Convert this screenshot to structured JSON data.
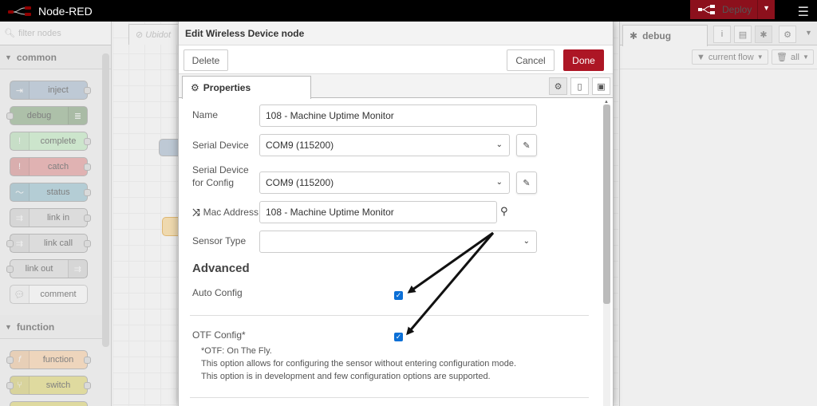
{
  "app": {
    "title": "Node-RED",
    "deploy_label": "Deploy"
  },
  "palette": {
    "filter_placeholder": "filter nodes",
    "categories": [
      {
        "label": "common",
        "nodes": [
          "inject",
          "debug",
          "complete",
          "catch",
          "status",
          "link in",
          "link call",
          "link out",
          "comment"
        ]
      },
      {
        "label": "function",
        "nodes": [
          "function",
          "switch"
        ]
      }
    ]
  },
  "workspace": {
    "tab_label": "Ubidot"
  },
  "sidebar": {
    "active_tab": "debug",
    "filter_label": "current flow",
    "clear_label": "all"
  },
  "dialog": {
    "title": "Edit Wireless Device node",
    "delete_label": "Delete",
    "cancel_label": "Cancel",
    "done_label": "Done",
    "tab_properties": "Properties",
    "fields": {
      "name_label": "Name",
      "name_value": "108 - Machine Uptime Monitor",
      "serial_label": "Serial Device",
      "serial_value": "COM9 (115200)",
      "serial_config_label_1": "Serial Device",
      "serial_config_label_2": "for Config",
      "serial_config_value": "COM9 (115200)",
      "mac_label": "Mac Address",
      "mac_value": "108 - Machine Uptime Monitor",
      "sensor_type_label": "Sensor Type",
      "sensor_type_value": ""
    },
    "advanced": {
      "title": "Advanced",
      "auto_config_label": "Auto Config",
      "auto_config_checked": true,
      "otf_config_label": "OTF Config*",
      "otf_config_checked": true,
      "otf_note_1": "*OTF: On The Fly.",
      "otf_note_2": "This option allows for configuring the sensor without entering configuration mode.",
      "otf_note_3": "This option is in development and few configuration options are supported."
    }
  },
  "colors": {
    "accent": "#ad1625",
    "deploy": "#8c101c",
    "checkbox": "#0b6fd6"
  }
}
